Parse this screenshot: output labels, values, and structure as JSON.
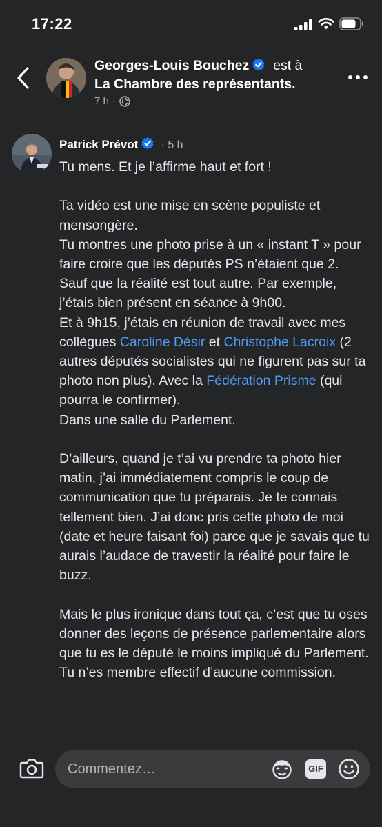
{
  "status_bar": {
    "time": "17:22"
  },
  "header": {
    "author": "Georges-Louis Bouchez",
    "verb": "est à",
    "place": "La Chambre des représentants.",
    "timestamp": "7 h",
    "separator": "·",
    "privacy_icon": "globe-icon"
  },
  "comment": {
    "author": "Patrick Prévot",
    "separator": "·",
    "timestamp": "5 h",
    "p1": "Tu mens. Et je l’affirme haut et fort !",
    "p2_a": "Ta vidéo est une mise en scène populiste et mensongère.",
    "p2_b": "Tu montres une photo prise à un « instant T » pour faire croire que les députés PS n’étaient que 2.",
    "p2_c": "Sauf que la réalité est tout autre. Par exemple, j’étais bien présent en séance à 9h00.",
    "p2_d_start": "Et à 9h15, j’étais en réunion de travail avec mes collègues ",
    "link_1": "Caroline Désir",
    "p2_d_and": " et ",
    "link_2": "Christophe Lacroix",
    "p2_d_mid": " (2 autres députés socialistes qui ne figurent pas sur ta photo non plus). Avec la ",
    "link_3": "Fédération Prisme",
    "p2_d_end": " (qui pourra le confirmer).",
    "p2_e": "Dans une salle du Parlement.",
    "p3": "D’ailleurs, quand je t’ai vu prendre ta photo hier matin, j’ai immédiatement compris le coup de communication que tu préparais. Je te connais tellement bien. J’ai donc pris cette photo de moi (date et heure faisant foi) parce que je savais que tu aurais l’audace de travestir la réalité pour faire le buzz.",
    "p4_a": "Mais le plus ironique dans tout ça, c’est que tu oses donner des leçons de présence parlementaire alors que tu es le député le moins impliqué du Parlement.",
    "p4_b": "Tu n’es membre effectif d’aucune commission."
  },
  "composer": {
    "placeholder": "Commentez…",
    "gif_label": "GIF"
  },
  "colors": {
    "background": "#242526",
    "link": "#4e9bf5",
    "verified": "#1877f2",
    "muted_text": "#b0b3b8"
  }
}
